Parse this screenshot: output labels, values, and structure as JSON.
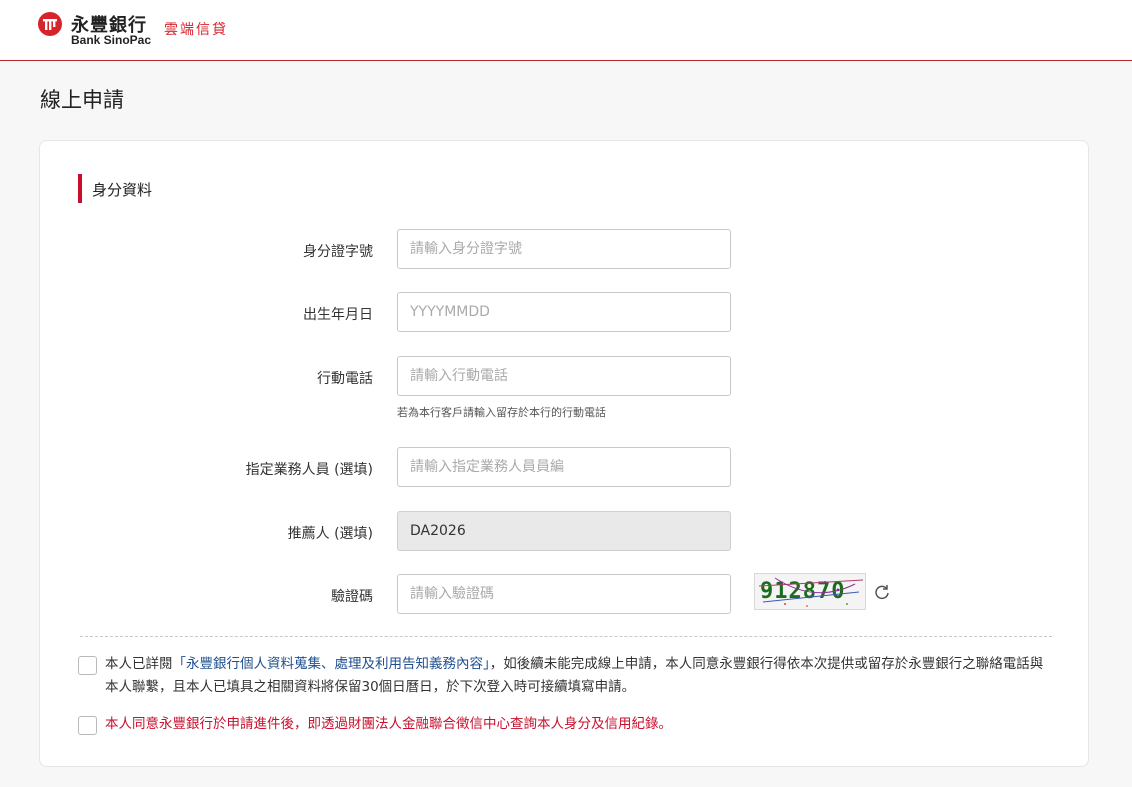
{
  "header": {
    "brand_cn": "永豐銀行",
    "brand_en": "Bank SinoPac",
    "service_name": "雲端信貸",
    "accent_color": "#d7242c"
  },
  "page": {
    "title": "線上申請"
  },
  "section": {
    "title": "身分資料"
  },
  "form": {
    "id_number": {
      "label": "身分證字號",
      "placeholder": "請輸入身分證字號",
      "value": ""
    },
    "birth_date": {
      "label": "出生年月日",
      "placeholder": "YYYYMMDD",
      "value": ""
    },
    "mobile": {
      "label": "行動電話",
      "placeholder": "請輸入行動電話",
      "value": "",
      "hint": "若為本行客戶請輸入留存於本行的行動電話"
    },
    "sales_rep": {
      "label": "指定業務人員 (選填)",
      "placeholder": "請輸入指定業務人員員編",
      "value": ""
    },
    "referrer": {
      "label": "推薦人 (選填)",
      "value": "DA2026"
    },
    "captcha": {
      "label": "驗證碼",
      "placeholder": "請輸入驗證碼",
      "value": "",
      "image_text": "912870",
      "refresh_icon": "refresh-icon"
    }
  },
  "consents": {
    "privacy_prefix": "本人已詳閱",
    "privacy_link": "「永豐銀行個人資料蒐集、處理及利用告知義務內容」",
    "privacy_suffix": "，如後續未能完成線上申請，本人同意永豐銀行得依本次提供或留存於永豐銀行之聯絡電話與本人聯繫，且本人已填具之相關資料將保留30個日曆日，於下次登入時可接續填寫申請。",
    "credit_check": "本人同意永豐銀行於申請進件後，即透過財團法人金融聯合徵信中心查詢本人身分及信用紀錄。"
  }
}
